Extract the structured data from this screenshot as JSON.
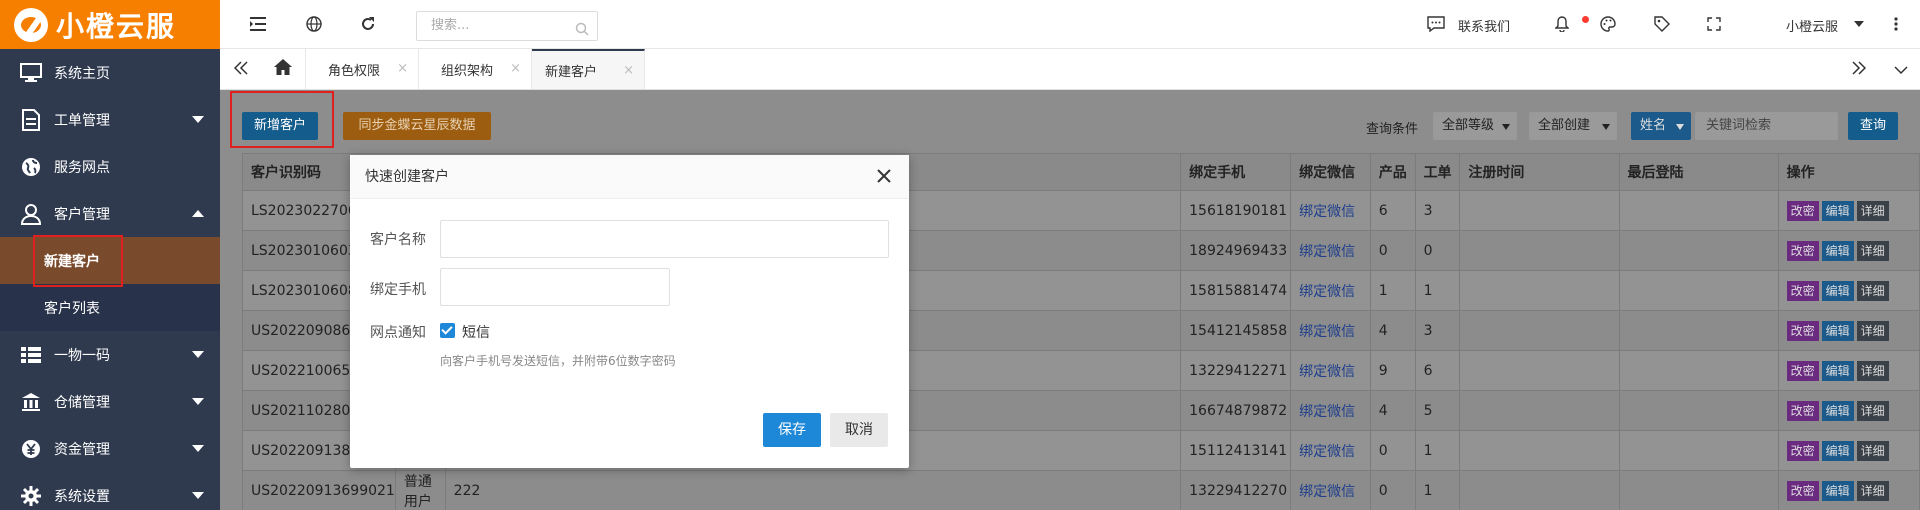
{
  "brand": {
    "name": "小橙云服",
    "color": "#f77f00"
  },
  "sidebar": {
    "items": [
      {
        "label": "系统主页",
        "icon": "monitor-icon"
      },
      {
        "label": "工单管理",
        "icon": "document-icon"
      },
      {
        "label": "服务网点",
        "icon": "globe-icon"
      },
      {
        "label": "客户管理",
        "icon": "user-icon"
      },
      {
        "label": "一物一码",
        "icon": "grid-icon"
      },
      {
        "label": "仓储管理",
        "icon": "warehouse-icon"
      },
      {
        "label": "资金管理",
        "icon": "money-icon"
      },
      {
        "label": "系统设置",
        "icon": "gear-icon"
      }
    ],
    "sub_items": [
      {
        "label": "新建客户",
        "active": true
      },
      {
        "label": "客户列表",
        "active": false
      }
    ]
  },
  "topbar": {
    "search_placeholder": "搜索...",
    "contact_label": "联系我们",
    "user_name": "小橙云服"
  },
  "tabs": [
    {
      "label": "角色权限"
    },
    {
      "label": "组织架构"
    },
    {
      "label": "新建客户",
      "active": true
    }
  ],
  "toolbar": {
    "new_customer": "新增客户",
    "sync_kingdee": "同步金蝶云星辰数据",
    "query_label": "查询条件",
    "level_select": "全部等级",
    "create_select": "全部创建",
    "field_select": "姓名",
    "keyword_placeholder": "关键词检索",
    "search_button": "查询"
  },
  "table": {
    "headers": [
      "客户识别码",
      "绑定手机",
      "绑定微信",
      "产品",
      "工单",
      "注册时间",
      "最后登陆",
      "操作"
    ],
    "rows": [
      {
        "code": "LS2023022706",
        "type": "",
        "name": "",
        "phone": "15618190181",
        "wechat": "绑定微信",
        "products": "6",
        "orders": "3"
      },
      {
        "code": "LS2023010603",
        "type": "",
        "name": "",
        "phone": "18924969433",
        "wechat": "绑定微信",
        "products": "0",
        "orders": "0"
      },
      {
        "code": "LS2023010608",
        "type": "",
        "name": "",
        "phone": "15815881474",
        "wechat": "绑定微信",
        "products": "1",
        "orders": "1"
      },
      {
        "code": "US2022090862",
        "type": "",
        "name": "",
        "phone": "15412145858",
        "wechat": "绑定微信",
        "products": "4",
        "orders": "3"
      },
      {
        "code": "US2022100655",
        "type": "",
        "name": "",
        "phone": "13229412271",
        "wechat": "绑定微信",
        "products": "9",
        "orders": "6"
      },
      {
        "code": "US2021102807",
        "type": "",
        "name": "",
        "phone": "16674879872",
        "wechat": "绑定微信",
        "products": "4",
        "orders": "5"
      },
      {
        "code": "US2022091383",
        "type": "",
        "name": "",
        "phone": "15112413141",
        "wechat": "绑定微信",
        "products": "0",
        "orders": "1"
      },
      {
        "code": "US20220913699021",
        "type": "普通用户",
        "name": "222",
        "phone": "13229412270",
        "wechat": "绑定微信",
        "products": "0",
        "orders": "1"
      }
    ],
    "ops": [
      "改密",
      "编辑",
      "详细"
    ]
  },
  "modal": {
    "title": "快速创建客户",
    "name_label": "客户名称",
    "phone_label": "绑定手机",
    "notify_label": "网点通知",
    "sms_label": "短信",
    "hint": "向客户手机号发送短信，并附带6位数字密码",
    "save": "保存",
    "cancel": "取消"
  },
  "colors": {
    "sidebar_bg": "#2f3a4f",
    "active_sub_bg": "#7a4a2c",
    "primary": "#1e88d8",
    "highlight_red": "#e0201f"
  }
}
